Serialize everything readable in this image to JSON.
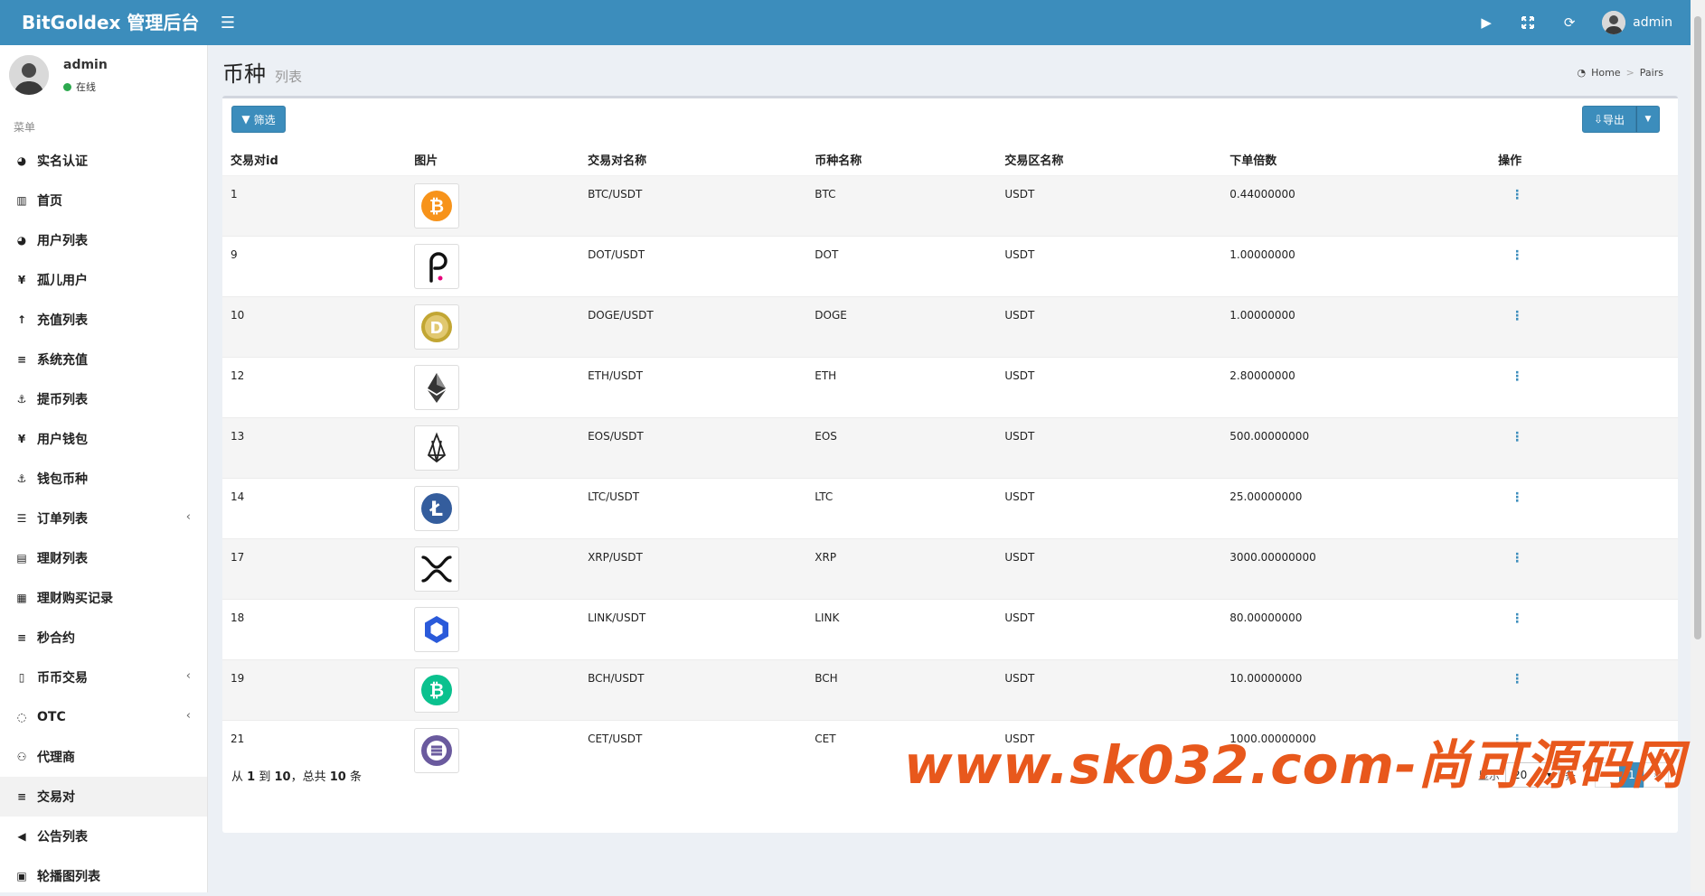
{
  "app": {
    "brand": "BitGoldex 管理后台",
    "user": "admin"
  },
  "sidebar": {
    "user_name": "admin",
    "status": "在线",
    "menu_header": "菜单",
    "items": [
      {
        "label": "实名认证",
        "icon": "globe-icon",
        "glyph": "◕",
        "chevron": false,
        "active": false
      },
      {
        "label": "首页",
        "icon": "bar-chart-icon",
        "glyph": "▥",
        "chevron": false,
        "active": false
      },
      {
        "label": "用户列表",
        "icon": "globe-icon",
        "glyph": "◕",
        "chevron": false,
        "active": false
      },
      {
        "label": "孤儿用户",
        "icon": "child-icon",
        "glyph": "¥",
        "chevron": false,
        "active": false
      },
      {
        "label": "充值列表",
        "icon": "arrow-up-icon",
        "glyph": "↑",
        "chevron": false,
        "active": false
      },
      {
        "label": "系统充值",
        "icon": "bars-icon",
        "glyph": "≡",
        "chevron": false,
        "active": false
      },
      {
        "label": "提币列表",
        "icon": "anchor-icon",
        "glyph": "⚓",
        "chevron": false,
        "active": false
      },
      {
        "label": "用户钱包",
        "icon": "yen-icon",
        "glyph": "¥",
        "chevron": false,
        "active": false
      },
      {
        "label": "钱包币种",
        "icon": "anchor-icon",
        "glyph": "⚓",
        "chevron": false,
        "active": false
      },
      {
        "label": "订单列表",
        "icon": "list-icon",
        "glyph": "☰",
        "chevron": true,
        "active": false
      },
      {
        "label": "理财列表",
        "icon": "briefcase-icon",
        "glyph": "▤",
        "chevron": false,
        "active": false
      },
      {
        "label": "理财购买记录",
        "icon": "dots-icon",
        "glyph": "▦",
        "chevron": false,
        "active": false
      },
      {
        "label": "秒合约",
        "icon": "bars-icon",
        "glyph": "≡",
        "chevron": false,
        "active": false
      },
      {
        "label": "币币交易",
        "icon": "building-icon",
        "glyph": "▯",
        "chevron": true,
        "active": false
      },
      {
        "label": "OTC",
        "icon": "circle-notch-icon",
        "glyph": "◌",
        "chevron": true,
        "active": false
      },
      {
        "label": "代理商",
        "icon": "users-icon",
        "glyph": "⚇",
        "chevron": false,
        "active": false
      },
      {
        "label": "交易对",
        "icon": "bars-icon",
        "glyph": "≡",
        "chevron": false,
        "active": true
      },
      {
        "label": "公告列表",
        "icon": "bullhorn-icon",
        "glyph": "◀",
        "chevron": false,
        "active": false
      },
      {
        "label": "轮播图列表",
        "icon": "image-icon",
        "glyph": "▣",
        "chevron": false,
        "active": false
      }
    ]
  },
  "page": {
    "title": "币种",
    "subtitle": "列表"
  },
  "breadcrumb": {
    "home": "Home",
    "current": "Pairs"
  },
  "toolbar": {
    "filter": "筛选",
    "export": "导出"
  },
  "table": {
    "headers": [
      "交易对id",
      "图片",
      "交易对名称",
      "币种名称",
      "交易区名称",
      "下单倍数",
      "操作"
    ],
    "rows": [
      {
        "id": "1",
        "pair": "BTC/USDT",
        "coin": "BTC",
        "zone": "USDT",
        "mult": "0.44000000",
        "icon": "btc-icon"
      },
      {
        "id": "9",
        "pair": "DOT/USDT",
        "coin": "DOT",
        "zone": "USDT",
        "mult": "1.00000000",
        "icon": "dot-icon"
      },
      {
        "id": "10",
        "pair": "DOGE/USDT",
        "coin": "DOGE",
        "zone": "USDT",
        "mult": "1.00000000",
        "icon": "doge-icon"
      },
      {
        "id": "12",
        "pair": "ETH/USDT",
        "coin": "ETH",
        "zone": "USDT",
        "mult": "2.80000000",
        "icon": "eth-icon"
      },
      {
        "id": "13",
        "pair": "EOS/USDT",
        "coin": "EOS",
        "zone": "USDT",
        "mult": "500.00000000",
        "icon": "eos-icon"
      },
      {
        "id": "14",
        "pair": "LTC/USDT",
        "coin": "LTC",
        "zone": "USDT",
        "mult": "25.00000000",
        "icon": "ltc-icon"
      },
      {
        "id": "17",
        "pair": "XRP/USDT",
        "coin": "XRP",
        "zone": "USDT",
        "mult": "3000.00000000",
        "icon": "xrp-icon"
      },
      {
        "id": "18",
        "pair": "LINK/USDT",
        "coin": "LINK",
        "zone": "USDT",
        "mult": "80.00000000",
        "icon": "link-icon"
      },
      {
        "id": "19",
        "pair": "BCH/USDT",
        "coin": "BCH",
        "zone": "USDT",
        "mult": "10.00000000",
        "icon": "bch-icon"
      },
      {
        "id": "21",
        "pair": "CET/USDT",
        "coin": "CET",
        "zone": "USDT",
        "mult": "1000.00000000",
        "icon": "cet-icon"
      }
    ]
  },
  "footer": {
    "info_prefix": "从",
    "from": "1",
    "info_to": "到",
    "to": "10",
    "info_total": "，总共",
    "total": "10",
    "info_suffix": "条",
    "show": "显示",
    "page_size": "20",
    "unit": "条",
    "prev": "«",
    "current_page": "1",
    "next": "»"
  },
  "watermark": "www.sk032.com-尚可源码网",
  "colors": {
    "primary": "#3c8dbc",
    "watermark": "#e8581c",
    "online": "#2da94f"
  }
}
